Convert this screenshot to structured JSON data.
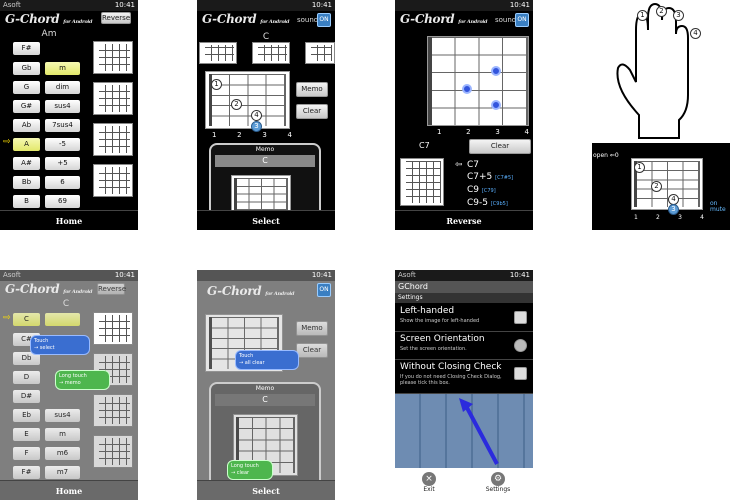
{
  "status": {
    "carrier": "Asoft",
    "time": "10:41"
  },
  "logo": {
    "main": "G-Chord",
    "sub": "for Android"
  },
  "p1": {
    "reverse": "Reverse",
    "chord": "Am",
    "nav": "Home",
    "keys": [
      "F#",
      "Gb",
      "G",
      "G#",
      "Ab",
      "A",
      "A#",
      "Bb",
      "B"
    ],
    "types": [
      "",
      "m",
      "dim",
      "sus4",
      "7sus4",
      "-5",
      "+5",
      "6",
      "69"
    ]
  },
  "p2": {
    "sound": "sound",
    "on": "ON",
    "chord": "C",
    "memo": "Memo",
    "clear": "Clear",
    "memo_title": "Memo",
    "memo_chord": "C",
    "nav": "Select",
    "frets": [
      "1",
      "2",
      "3",
      "4"
    ],
    "fingers": [
      "1",
      "2",
      "4",
      "3"
    ]
  },
  "p3": {
    "sound": "sound",
    "on": "ON",
    "clear": "Clear",
    "chord": "C7",
    "nav": "Reverse",
    "frets": [
      "1",
      "2",
      "3",
      "4"
    ],
    "list": [
      {
        "n": "C7",
        "a": ""
      },
      {
        "n": "C7+5",
        "a": "[C7#5]"
      },
      {
        "n": "C9",
        "a": "[C79]"
      },
      {
        "n": "C9-5",
        "a": "[C9b5]"
      }
    ]
  },
  "p4": {
    "open": "open",
    "zero": "0",
    "on": "on",
    "mute": "mute",
    "frets": [
      "1",
      "2",
      "3",
      "4"
    ],
    "fingers": [
      "1",
      "2",
      "3",
      "4"
    ]
  },
  "p5": {
    "reverse": "Reverse",
    "chord": "C",
    "nav": "Home",
    "keys": [
      "C",
      "C#",
      "Db",
      "D",
      "D#",
      "Eb",
      "E",
      "F",
      "F#"
    ],
    "types": [
      "",
      "",
      "",
      "",
      "",
      "sus4",
      "m",
      "m6",
      "m7"
    ],
    "touch": "Touch",
    "touch_sub": "→ select",
    "long": "Long touch",
    "long_sub": "→ memo"
  },
  "p6": {
    "on": "ON",
    "memo": "Memo",
    "clear": "Clear",
    "memo_title": "Memo",
    "memo_chord": "C",
    "nav": "Select",
    "touch": "Touch",
    "touch_sub": "→ all clear",
    "long": "Long touch",
    "long_sub": "→ clear"
  },
  "p7": {
    "app": "GChord",
    "settings": "Settings",
    "items": [
      {
        "t": "Left-handed",
        "s": "Show the image for left-handed"
      },
      {
        "t": "Screen Orientation",
        "s": "Set the screen orientation."
      },
      {
        "t": "Without Closing Check",
        "s": "If you do not need Closing Check Dialog, please tick this box."
      }
    ],
    "exit": "Exit",
    "settings_btn": "Settings"
  },
  "colors": {
    "accent": "#3a7fc2",
    "highlight": "#e2e86a",
    "arrow": "#ffe000"
  }
}
